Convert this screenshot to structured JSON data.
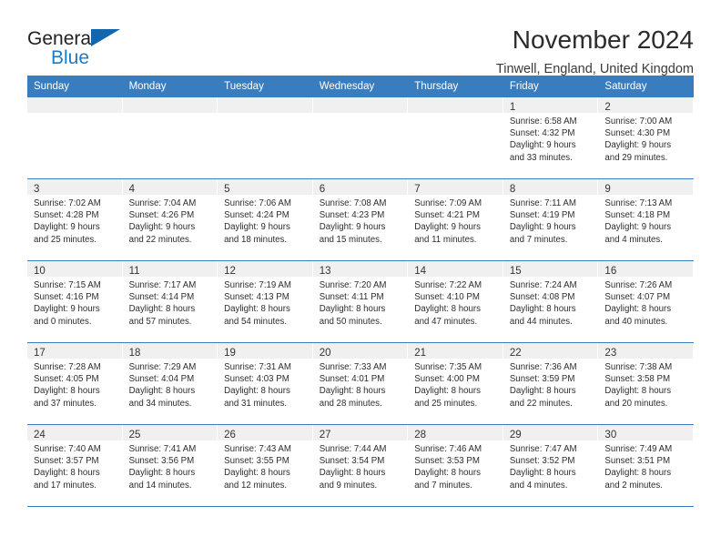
{
  "brand": {
    "line1": "General",
    "line2": "Blue",
    "triangle_color": "#1266ae",
    "blue_text_color": "#1f7ac4"
  },
  "header": {
    "title": "November 2024",
    "subtitle": "Tinwell, England, United Kingdom"
  },
  "theme": {
    "header_blue": "#3a7dbf",
    "day_band_gray": "#f0f0f0"
  },
  "weekdays": [
    "Sunday",
    "Monday",
    "Tuesday",
    "Wednesday",
    "Thursday",
    "Friday",
    "Saturday"
  ],
  "weeks": [
    [
      {
        "day": "",
        "sunrise": "",
        "sunset": "",
        "daylight1": "",
        "daylight2": ""
      },
      {
        "day": "",
        "sunrise": "",
        "sunset": "",
        "daylight1": "",
        "daylight2": ""
      },
      {
        "day": "",
        "sunrise": "",
        "sunset": "",
        "daylight1": "",
        "daylight2": ""
      },
      {
        "day": "",
        "sunrise": "",
        "sunset": "",
        "daylight1": "",
        "daylight2": ""
      },
      {
        "day": "",
        "sunrise": "",
        "sunset": "",
        "daylight1": "",
        "daylight2": ""
      },
      {
        "day": "1",
        "sunrise": "Sunrise: 6:58 AM",
        "sunset": "Sunset: 4:32 PM",
        "daylight1": "Daylight: 9 hours",
        "daylight2": "and 33 minutes."
      },
      {
        "day": "2",
        "sunrise": "Sunrise: 7:00 AM",
        "sunset": "Sunset: 4:30 PM",
        "daylight1": "Daylight: 9 hours",
        "daylight2": "and 29 minutes."
      }
    ],
    [
      {
        "day": "3",
        "sunrise": "Sunrise: 7:02 AM",
        "sunset": "Sunset: 4:28 PM",
        "daylight1": "Daylight: 9 hours",
        "daylight2": "and 25 minutes."
      },
      {
        "day": "4",
        "sunrise": "Sunrise: 7:04 AM",
        "sunset": "Sunset: 4:26 PM",
        "daylight1": "Daylight: 9 hours",
        "daylight2": "and 22 minutes."
      },
      {
        "day": "5",
        "sunrise": "Sunrise: 7:06 AM",
        "sunset": "Sunset: 4:24 PM",
        "daylight1": "Daylight: 9 hours",
        "daylight2": "and 18 minutes."
      },
      {
        "day": "6",
        "sunrise": "Sunrise: 7:08 AM",
        "sunset": "Sunset: 4:23 PM",
        "daylight1": "Daylight: 9 hours",
        "daylight2": "and 15 minutes."
      },
      {
        "day": "7",
        "sunrise": "Sunrise: 7:09 AM",
        "sunset": "Sunset: 4:21 PM",
        "daylight1": "Daylight: 9 hours",
        "daylight2": "and 11 minutes."
      },
      {
        "day": "8",
        "sunrise": "Sunrise: 7:11 AM",
        "sunset": "Sunset: 4:19 PM",
        "daylight1": "Daylight: 9 hours",
        "daylight2": "and 7 minutes."
      },
      {
        "day": "9",
        "sunrise": "Sunrise: 7:13 AM",
        "sunset": "Sunset: 4:18 PM",
        "daylight1": "Daylight: 9 hours",
        "daylight2": "and 4 minutes."
      }
    ],
    [
      {
        "day": "10",
        "sunrise": "Sunrise: 7:15 AM",
        "sunset": "Sunset: 4:16 PM",
        "daylight1": "Daylight: 9 hours",
        "daylight2": "and 0 minutes."
      },
      {
        "day": "11",
        "sunrise": "Sunrise: 7:17 AM",
        "sunset": "Sunset: 4:14 PM",
        "daylight1": "Daylight: 8 hours",
        "daylight2": "and 57 minutes."
      },
      {
        "day": "12",
        "sunrise": "Sunrise: 7:19 AM",
        "sunset": "Sunset: 4:13 PM",
        "daylight1": "Daylight: 8 hours",
        "daylight2": "and 54 minutes."
      },
      {
        "day": "13",
        "sunrise": "Sunrise: 7:20 AM",
        "sunset": "Sunset: 4:11 PM",
        "daylight1": "Daylight: 8 hours",
        "daylight2": "and 50 minutes."
      },
      {
        "day": "14",
        "sunrise": "Sunrise: 7:22 AM",
        "sunset": "Sunset: 4:10 PM",
        "daylight1": "Daylight: 8 hours",
        "daylight2": "and 47 minutes."
      },
      {
        "day": "15",
        "sunrise": "Sunrise: 7:24 AM",
        "sunset": "Sunset: 4:08 PM",
        "daylight1": "Daylight: 8 hours",
        "daylight2": "and 44 minutes."
      },
      {
        "day": "16",
        "sunrise": "Sunrise: 7:26 AM",
        "sunset": "Sunset: 4:07 PM",
        "daylight1": "Daylight: 8 hours",
        "daylight2": "and 40 minutes."
      }
    ],
    [
      {
        "day": "17",
        "sunrise": "Sunrise: 7:28 AM",
        "sunset": "Sunset: 4:05 PM",
        "daylight1": "Daylight: 8 hours",
        "daylight2": "and 37 minutes."
      },
      {
        "day": "18",
        "sunrise": "Sunrise: 7:29 AM",
        "sunset": "Sunset: 4:04 PM",
        "daylight1": "Daylight: 8 hours",
        "daylight2": "and 34 minutes."
      },
      {
        "day": "19",
        "sunrise": "Sunrise: 7:31 AM",
        "sunset": "Sunset: 4:03 PM",
        "daylight1": "Daylight: 8 hours",
        "daylight2": "and 31 minutes."
      },
      {
        "day": "20",
        "sunrise": "Sunrise: 7:33 AM",
        "sunset": "Sunset: 4:01 PM",
        "daylight1": "Daylight: 8 hours",
        "daylight2": "and 28 minutes."
      },
      {
        "day": "21",
        "sunrise": "Sunrise: 7:35 AM",
        "sunset": "Sunset: 4:00 PM",
        "daylight1": "Daylight: 8 hours",
        "daylight2": "and 25 minutes."
      },
      {
        "day": "22",
        "sunrise": "Sunrise: 7:36 AM",
        "sunset": "Sunset: 3:59 PM",
        "daylight1": "Daylight: 8 hours",
        "daylight2": "and 22 minutes."
      },
      {
        "day": "23",
        "sunrise": "Sunrise: 7:38 AM",
        "sunset": "Sunset: 3:58 PM",
        "daylight1": "Daylight: 8 hours",
        "daylight2": "and 20 minutes."
      }
    ],
    [
      {
        "day": "24",
        "sunrise": "Sunrise: 7:40 AM",
        "sunset": "Sunset: 3:57 PM",
        "daylight1": "Daylight: 8 hours",
        "daylight2": "and 17 minutes."
      },
      {
        "day": "25",
        "sunrise": "Sunrise: 7:41 AM",
        "sunset": "Sunset: 3:56 PM",
        "daylight1": "Daylight: 8 hours",
        "daylight2": "and 14 minutes."
      },
      {
        "day": "26",
        "sunrise": "Sunrise: 7:43 AM",
        "sunset": "Sunset: 3:55 PM",
        "daylight1": "Daylight: 8 hours",
        "daylight2": "and 12 minutes."
      },
      {
        "day": "27",
        "sunrise": "Sunrise: 7:44 AM",
        "sunset": "Sunset: 3:54 PM",
        "daylight1": "Daylight: 8 hours",
        "daylight2": "and 9 minutes."
      },
      {
        "day": "28",
        "sunrise": "Sunrise: 7:46 AM",
        "sunset": "Sunset: 3:53 PM",
        "daylight1": "Daylight: 8 hours",
        "daylight2": "and 7 minutes."
      },
      {
        "day": "29",
        "sunrise": "Sunrise: 7:47 AM",
        "sunset": "Sunset: 3:52 PM",
        "daylight1": "Daylight: 8 hours",
        "daylight2": "and 4 minutes."
      },
      {
        "day": "30",
        "sunrise": "Sunrise: 7:49 AM",
        "sunset": "Sunset: 3:51 PM",
        "daylight1": "Daylight: 8 hours",
        "daylight2": "and 2 minutes."
      }
    ]
  ]
}
